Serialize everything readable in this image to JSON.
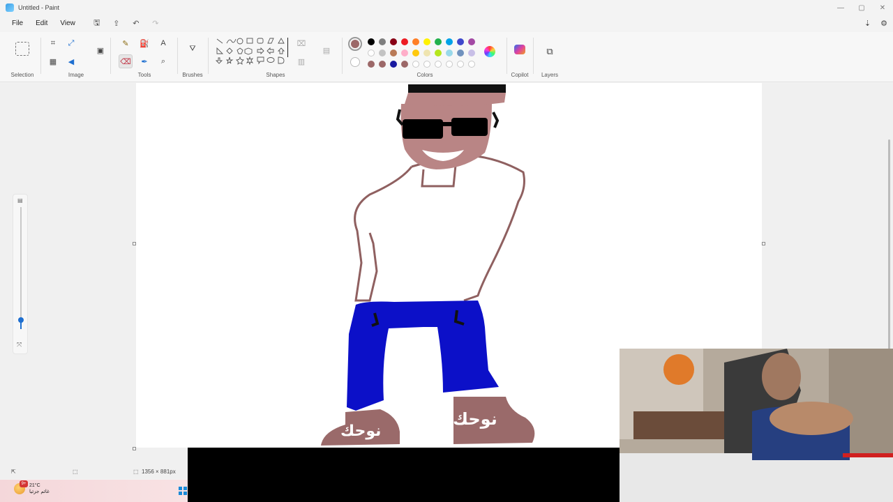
{
  "window": {
    "title": "Untitled - Paint",
    "controls": [
      "—",
      "▢",
      "✕"
    ]
  },
  "menu": {
    "items": [
      "File",
      "Edit",
      "View"
    ]
  },
  "ribbon": {
    "groups": {
      "selection": "Selection",
      "image": "Image",
      "tools": "Tools",
      "brushes": "Brushes",
      "shapes": "Shapes",
      "colors": "Colors",
      "copilot": "Copilot",
      "layers": "Layers"
    },
    "selected_color": "#9c6868",
    "palette_row1": [
      "#000000",
      "#7f7f7f",
      "#880015",
      "#ed1c24",
      "#ff7f27",
      "#fff200",
      "#22b14c",
      "#00a2e8",
      "#3f48cc",
      "#a349a4"
    ],
    "palette_row2": [
      "#ffffff",
      "#c3c3c3",
      "#b97a57",
      "#ffaec9",
      "#ffc90e",
      "#efe4b0",
      "#b5e61d",
      "#99d9ea",
      "#7092be",
      "#c8bfe7"
    ],
    "palette_row3": [
      "#9c6868",
      "#9c6868",
      "#1a1aa0",
      "#9c6868",
      "",
      "",
      "",
      "",
      "",
      ""
    ]
  },
  "status": {
    "canvas_size": "1356 × 881px"
  },
  "taskbar": {
    "temperature": "21°C",
    "weather_desc": "غائم جزئيا",
    "notif_count": "9+"
  },
  "drawing": {
    "shoe_text_left": "نوحك",
    "shoe_text_right": "نوحك",
    "skin": "#b98585",
    "outline": "#8f6060",
    "pants": "#0c10c8",
    "shoes": "#9a6a6a"
  }
}
